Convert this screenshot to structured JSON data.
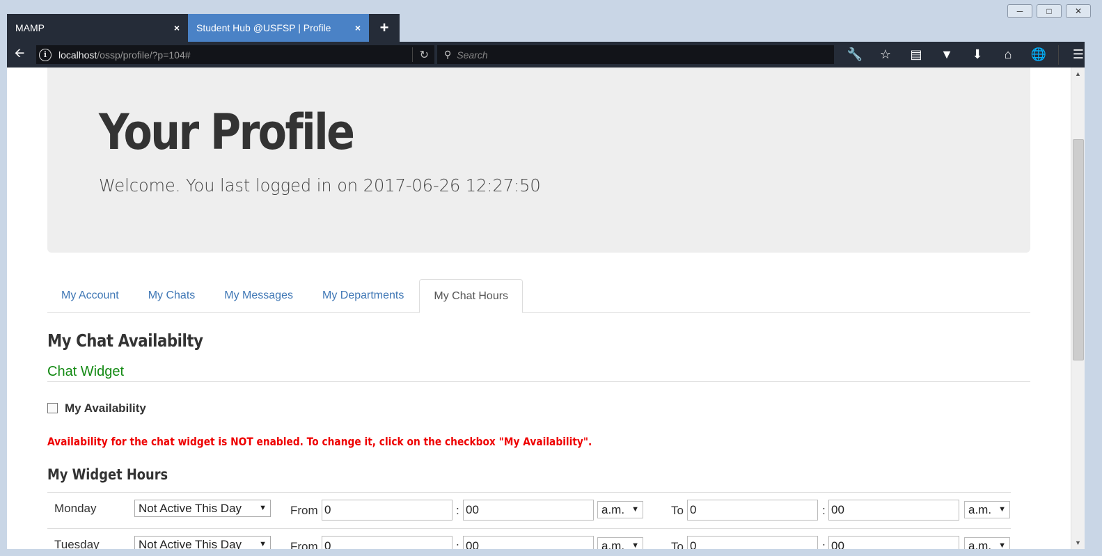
{
  "browser": {
    "tabs": [
      {
        "label": "MAMP",
        "close": "×"
      },
      {
        "label": "Student Hub @USFSP | Profile",
        "close": "×"
      }
    ],
    "new_tab": "+",
    "url_host": "localhost",
    "url_path": "/ossp/profile/?p=104#",
    "search_placeholder": "Search"
  },
  "jumbotron": {
    "title": "Your Profile",
    "subtitle": "Welcome. You last logged in on 2017-06-26 12:27:50"
  },
  "tabs": [
    {
      "label": "My Account",
      "active": false
    },
    {
      "label": "My Chats",
      "active": false
    },
    {
      "label": "My Messages",
      "active": false
    },
    {
      "label": "My Departments",
      "active": false
    },
    {
      "label": "My Chat Hours",
      "active": true
    }
  ],
  "availability": {
    "heading": "My Chat Availabilty",
    "widget_title": "Chat Widget",
    "checkbox_label": "My Availability",
    "checked": false,
    "warning": "Availability for the chat widget is NOT enabled. To change it, click on the checkbox \"My Availability\"."
  },
  "hours": {
    "heading": "My Widget Hours",
    "from_label": "From",
    "to_label": "To",
    "colon": ":",
    "rows": [
      {
        "day": "Monday",
        "status": "Not Active This Day",
        "from_hour": "0",
        "from_min": "00",
        "from_ampm": "a.m.",
        "to_hour": "0",
        "to_min": "00",
        "to_ampm": "a.m."
      },
      {
        "day": "Tuesday",
        "status": "Not Active This Day",
        "from_hour": "0",
        "from_min": "00",
        "from_ampm": "a.m.",
        "to_hour": "0",
        "to_min": "00",
        "to_ampm": "a.m."
      }
    ]
  }
}
